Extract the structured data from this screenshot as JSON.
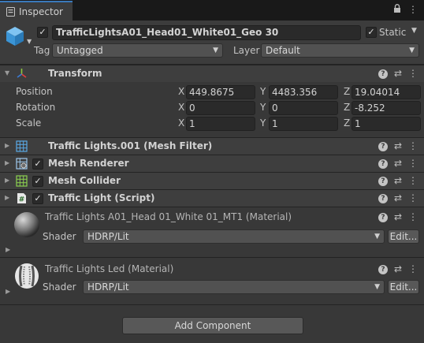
{
  "tab": {
    "label": "Inspector",
    "tools": [
      "lock-icon",
      "kebab-menu-icon"
    ]
  },
  "header": {
    "name_checked": true,
    "object_name": "TrafficLightsA01_Head01_White01_Geo 30",
    "static_checked": true,
    "static_label": "Static",
    "tag_label": "Tag",
    "tag_value": "Untagged",
    "layer_label": "Layer",
    "layer_value": "Default"
  },
  "transform": {
    "title": "Transform",
    "rows": [
      {
        "label": "Position",
        "x": "449.8675",
        "y": "4483.356",
        "z": "19.04014"
      },
      {
        "label": "Rotation",
        "x": "0",
        "y": "0",
        "z": "-8.252"
      },
      {
        "label": "Scale",
        "x": "1",
        "y": "1",
        "z": "1"
      }
    ],
    "axis_labels": [
      "X",
      "Y",
      "Z"
    ]
  },
  "components": [
    {
      "title": "Traffic Lights.001 (Mesh Filter)",
      "has_checkbox": false,
      "icon": "mesh-filter-icon"
    },
    {
      "title": "Mesh Renderer",
      "has_checkbox": true,
      "icon": "mesh-renderer-icon"
    },
    {
      "title": "Mesh Collider",
      "has_checkbox": true,
      "icon": "mesh-collider-icon"
    },
    {
      "title": "Traffic Light (Script)",
      "has_checkbox": true,
      "icon": "script-icon"
    }
  ],
  "materials": [
    {
      "title": "Traffic Lights A01_Head 01_White 01_MT1 (Material)",
      "shader_label": "Shader",
      "shader_value": "HDRP/Lit",
      "edit_label": "Edit..."
    },
    {
      "title": "Traffic Lights Led (Material)",
      "shader_label": "Shader",
      "shader_value": "HDRP/Lit",
      "edit_label": "Edit..."
    }
  ],
  "add_component_label": "Add Component",
  "colors": {
    "accent": "#3a79bb",
    "panel": "#383838",
    "header": "#3e3e3e",
    "field": "#2a2a2a"
  }
}
